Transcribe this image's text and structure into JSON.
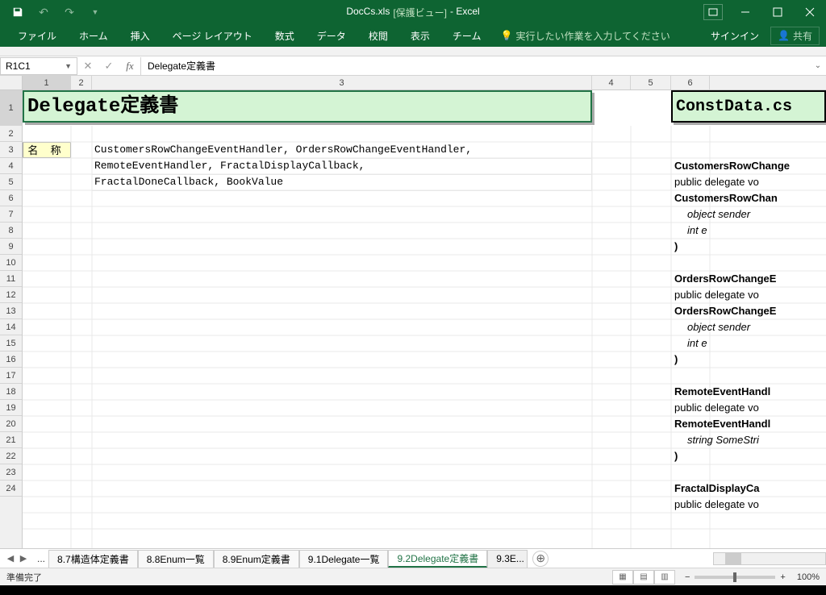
{
  "title": {
    "filename": "DocCs.xls",
    "protected": "[保護ビュー]",
    "app": "- Excel"
  },
  "ribbon": {
    "tabs": [
      "ファイル",
      "ホーム",
      "挿入",
      "ページ レイアウト",
      "数式",
      "データ",
      "校閲",
      "表示",
      "チーム"
    ],
    "tellme": "実行したい作業を入力してください",
    "signin": "サインイン",
    "share": "共有"
  },
  "formula": {
    "ref": "R1C1",
    "value": "Delegate定義書"
  },
  "columns": [
    "1",
    "2",
    "3",
    "4",
    "5",
    "6"
  ],
  "rows": [
    "1",
    "2",
    "3",
    "4",
    "5",
    "6",
    "7",
    "8",
    "9",
    "10",
    "11",
    "12",
    "13",
    "14",
    "15",
    "16",
    "17",
    "18",
    "19",
    "20",
    "21",
    "22",
    "23",
    "24"
  ],
  "sheet": {
    "title": "Delegate定義書",
    "label": "名 称",
    "lines": [
      "CustomersRowChangeEventHandler, OrdersRowChangeEventHandler,",
      "RemoteEventHandler, FractalDisplayCallback,",
      "FractalDoneCallback, BookValue"
    ]
  },
  "right": {
    "title": "ConstData.cs",
    "blocks": [
      [
        "CustomersRowChange",
        "public delegate vo",
        "CustomersRowChan",
        "  object sender",
        "  int e",
        ")"
      ],
      [
        "OrdersRowChangeE",
        "public delegate vo",
        "OrdersRowChangeE",
        "  object sender",
        "  int e",
        ")"
      ],
      [
        "RemoteEventHandl",
        "public delegate vo",
        "RemoteEventHandl",
        "  string SomeStri",
        ")"
      ],
      [
        "FractalDisplayCa",
        "public delegate vo"
      ]
    ]
  },
  "tabs": {
    "list": [
      "8.7構造体定義書",
      "8.8Enum一覧",
      "8.9Enum定義書",
      "9.1Delegate一覧",
      "9.2Delegate定義書"
    ],
    "partial": "9.3E",
    "active": 4
  },
  "status": {
    "ready": "準備完了",
    "zoom": "100%"
  }
}
